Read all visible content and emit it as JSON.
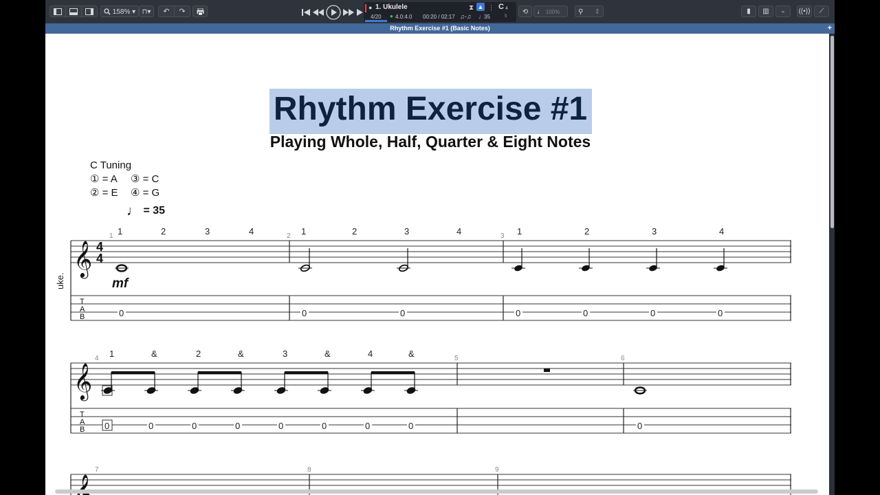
{
  "toolbar": {
    "zoom": "158%",
    "track_name": "1. Ukulele",
    "bar_position": "4/20",
    "beat_position": "4.0:4.0",
    "time_position": "00:20 / 02:17",
    "tempo_display": "35",
    "key_display": "C",
    "key_octave": "4",
    "volume": "100%"
  },
  "tab": {
    "title": "Rhythm Exercise #1 (Basic Notes)",
    "plus": "+"
  },
  "score": {
    "title": "Rhythm Exercise #1",
    "subtitle": "Playing Whole, Half, Quarter & Eight Notes",
    "tuning": {
      "label": "C Tuning",
      "s1": "① = A",
      "s3": "③ = C",
      "s2": "② = E",
      "s4": "④ = G"
    },
    "tempo": "= 35",
    "instrument_label": "uke.",
    "dynamic": "mf",
    "time_signature": {
      "top": "4",
      "bottom": "4"
    },
    "tab_clef": [
      "T",
      "A",
      "B"
    ],
    "measures": [
      {
        "number": "1",
        "counts": [
          "1",
          "2",
          "3",
          "4"
        ],
        "frets": [
          "0"
        ]
      },
      {
        "number": "2",
        "counts": [
          "1",
          "2",
          "3",
          "4"
        ],
        "frets": [
          "0",
          "0"
        ]
      },
      {
        "number": "3",
        "counts": [
          "1",
          "2",
          "3",
          "4"
        ],
        "frets": [
          "0",
          "0",
          "0",
          "0"
        ]
      },
      {
        "number": "4",
        "counts": [
          "1",
          "&",
          "2",
          "&",
          "3",
          "&",
          "4",
          "&"
        ],
        "frets": [
          "0",
          "0",
          "0",
          "0",
          "0",
          "0",
          "0",
          "0"
        ]
      },
      {
        "number": "5",
        "counts": [],
        "frets": []
      },
      {
        "number": "6",
        "counts": [],
        "frets": [
          "0"
        ]
      },
      {
        "number": "7",
        "counts": [],
        "frets": []
      },
      {
        "number": "8",
        "counts": [],
        "frets": []
      },
      {
        "number": "9",
        "counts": [],
        "frets": []
      }
    ]
  }
}
